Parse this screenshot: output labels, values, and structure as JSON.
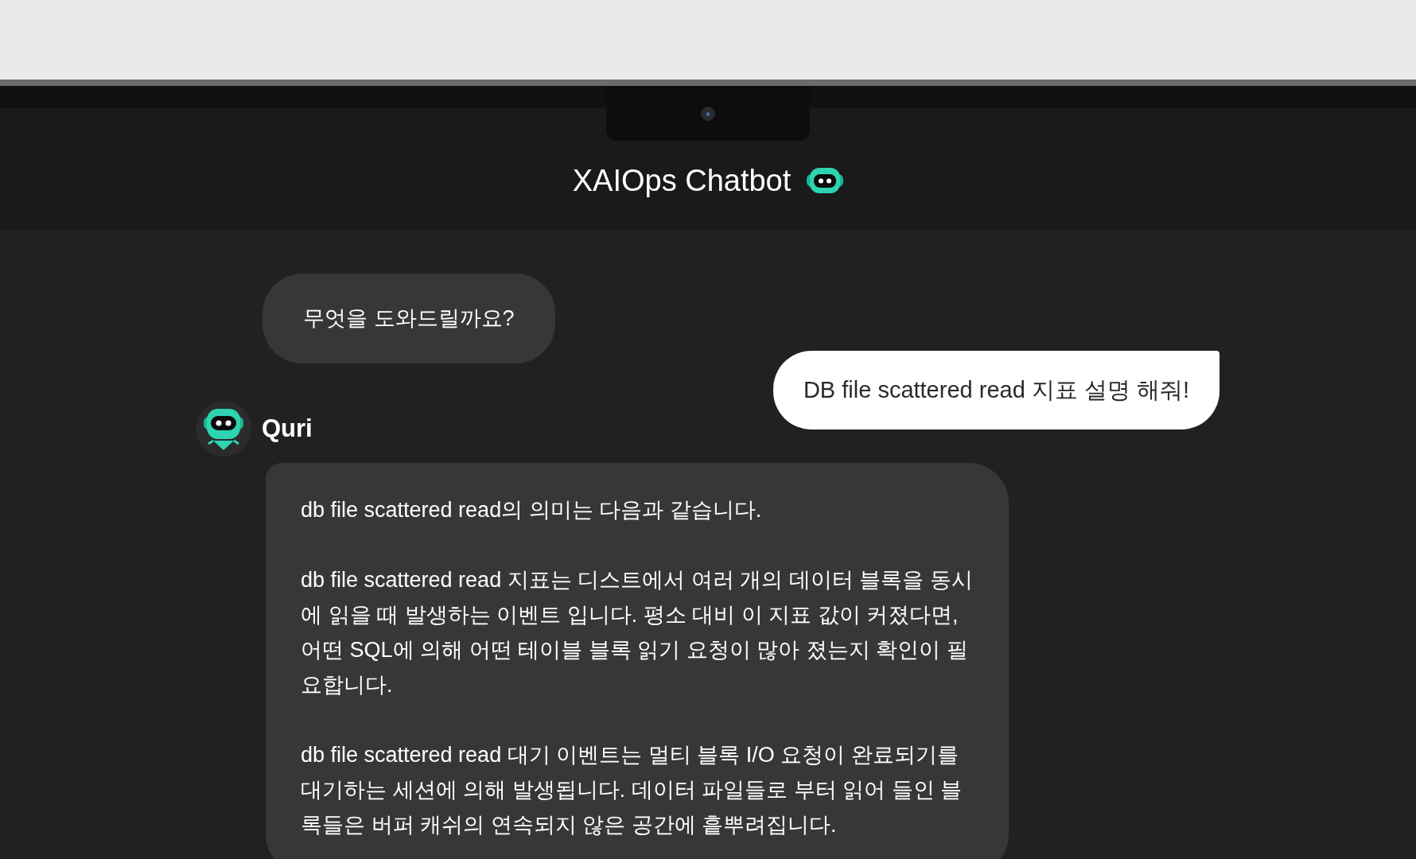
{
  "header": {
    "title": "XAIOps Chatbot"
  },
  "messages": [
    {
      "kind": "bot",
      "text": "무엇을 도와드릴까요?"
    },
    {
      "kind": "user",
      "text": "DB file scattered read 지표 설명 해줘!"
    },
    {
      "kind": "bot-named",
      "sender": "Quri",
      "paragraphs": [
        "db file scattered read의 의미는 다음과 같습니다.",
        "db file scattered read 지표는 디스트에서 여러 개의 데이터 블록을 동시에 읽을 때 발생하는 이벤트 입니다. 평소 대비 이 지표 값이 커졌다면, 어떤 SQL에 의해 어떤 테이블 블록 읽기 요청이 많아 졌는지 확인이 필요합니다.",
        "db file scattered read 대기 이벤트는 멀티 블록 I/O 요청이 완료되기를 대기하는 세션에 의해 발생됩니다. 데이터 파일들로 부터 읽어 들인 블록들은 버퍼 캐쉬의 연속되지 않은 공간에 흩뿌려집니다."
      ]
    }
  ]
}
